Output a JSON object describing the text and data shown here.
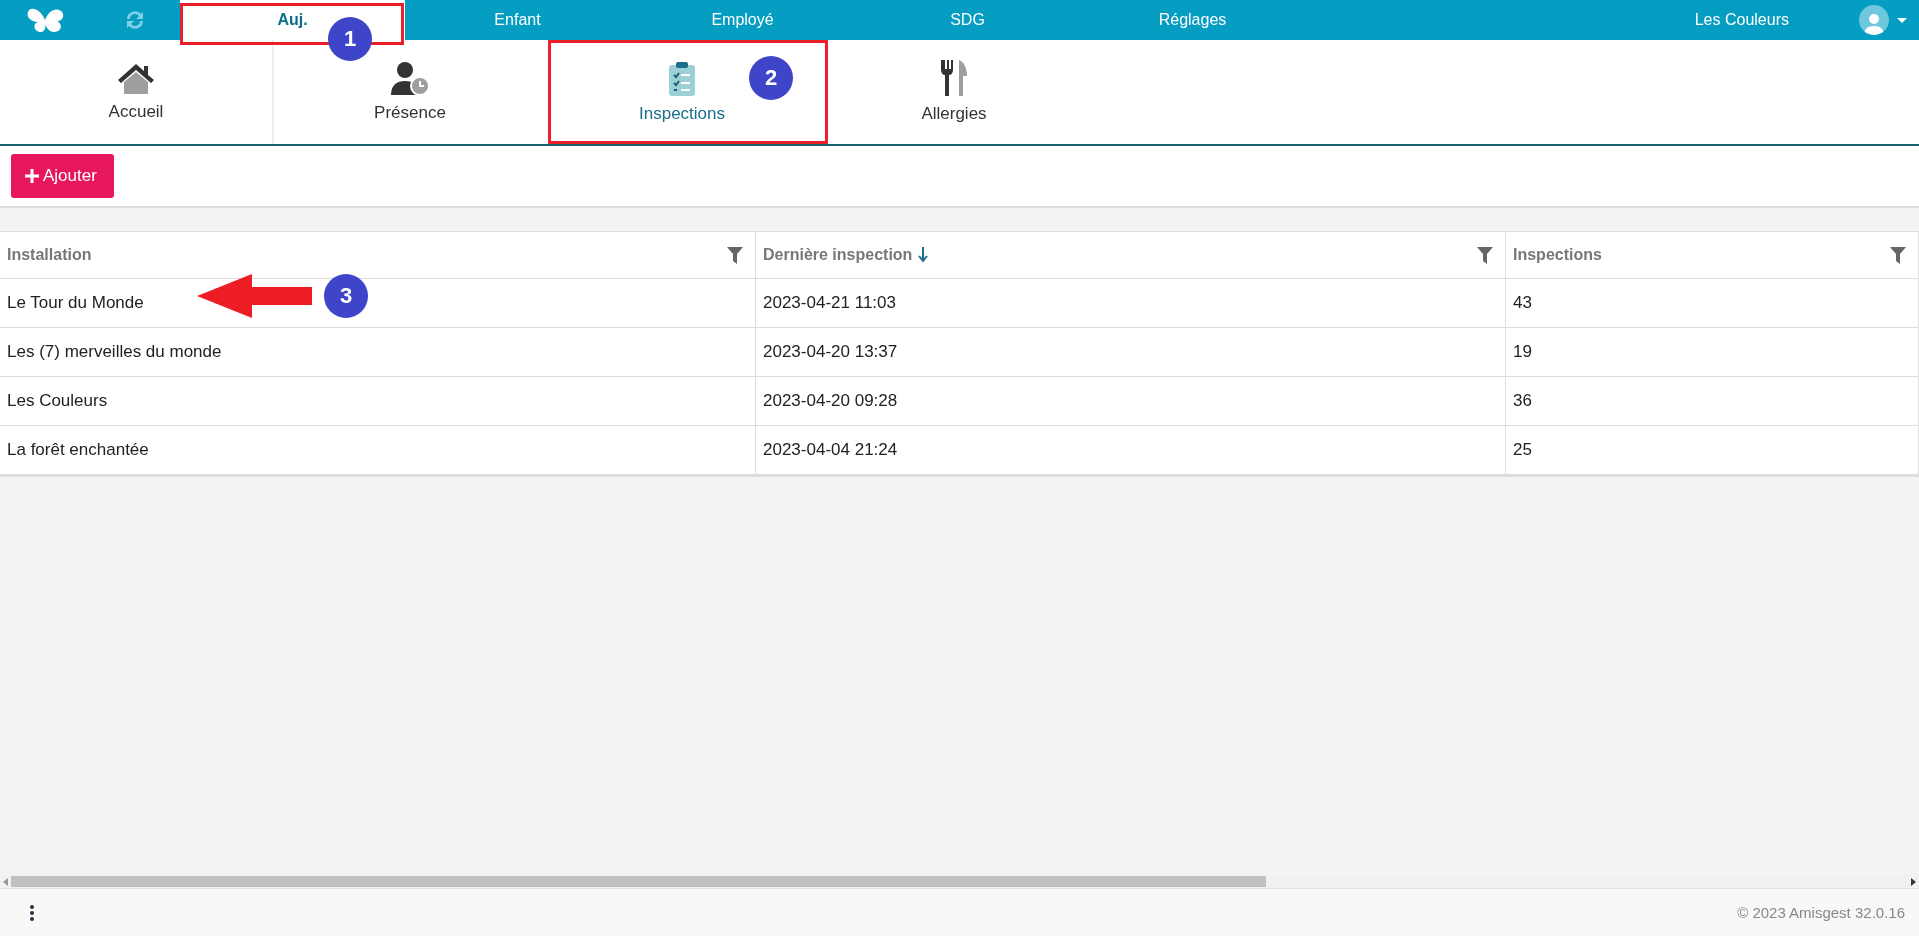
{
  "top_nav": {
    "items": [
      {
        "label": "Auj.",
        "selected": true
      },
      {
        "label": "Enfant",
        "selected": false
      },
      {
        "label": "Employé",
        "selected": false
      },
      {
        "label": "SDG",
        "selected": false
      },
      {
        "label": "Réglages",
        "selected": false
      }
    ],
    "site": "Les Couleurs"
  },
  "sub_tabs": [
    {
      "label": "Accueil",
      "kind": "home",
      "selected": false
    },
    {
      "label": "Présence",
      "kind": "presence",
      "selected": false
    },
    {
      "label": "Inspections",
      "kind": "inspections",
      "selected": true
    },
    {
      "label": "Allergies",
      "kind": "allergies",
      "selected": false
    }
  ],
  "toolbar": {
    "add_button": "Ajouter"
  },
  "table": {
    "columns": [
      {
        "label": "Installation",
        "sorted": false
      },
      {
        "label": "Dernière inspection",
        "sorted": true
      },
      {
        "label": "Inspections",
        "sorted": false
      }
    ],
    "rows": [
      [
        "Le Tour du Monde",
        "2023-04-21 11:03",
        "43"
      ],
      [
        "Les (7) merveilles du monde",
        "2023-04-20 13:37",
        "19"
      ],
      [
        "Les Couleurs",
        "2023-04-20 09:28",
        "36"
      ],
      [
        "La forêt enchantée",
        "2023-04-04 21:24",
        "25"
      ]
    ]
  },
  "annotations": [
    {
      "number": "1",
      "kind": "box"
    },
    {
      "number": "2",
      "kind": "box"
    },
    {
      "number": "3",
      "kind": "arrow"
    }
  ],
  "footer": {
    "copyright": "© 2023 Amisgest 32.0.16"
  }
}
